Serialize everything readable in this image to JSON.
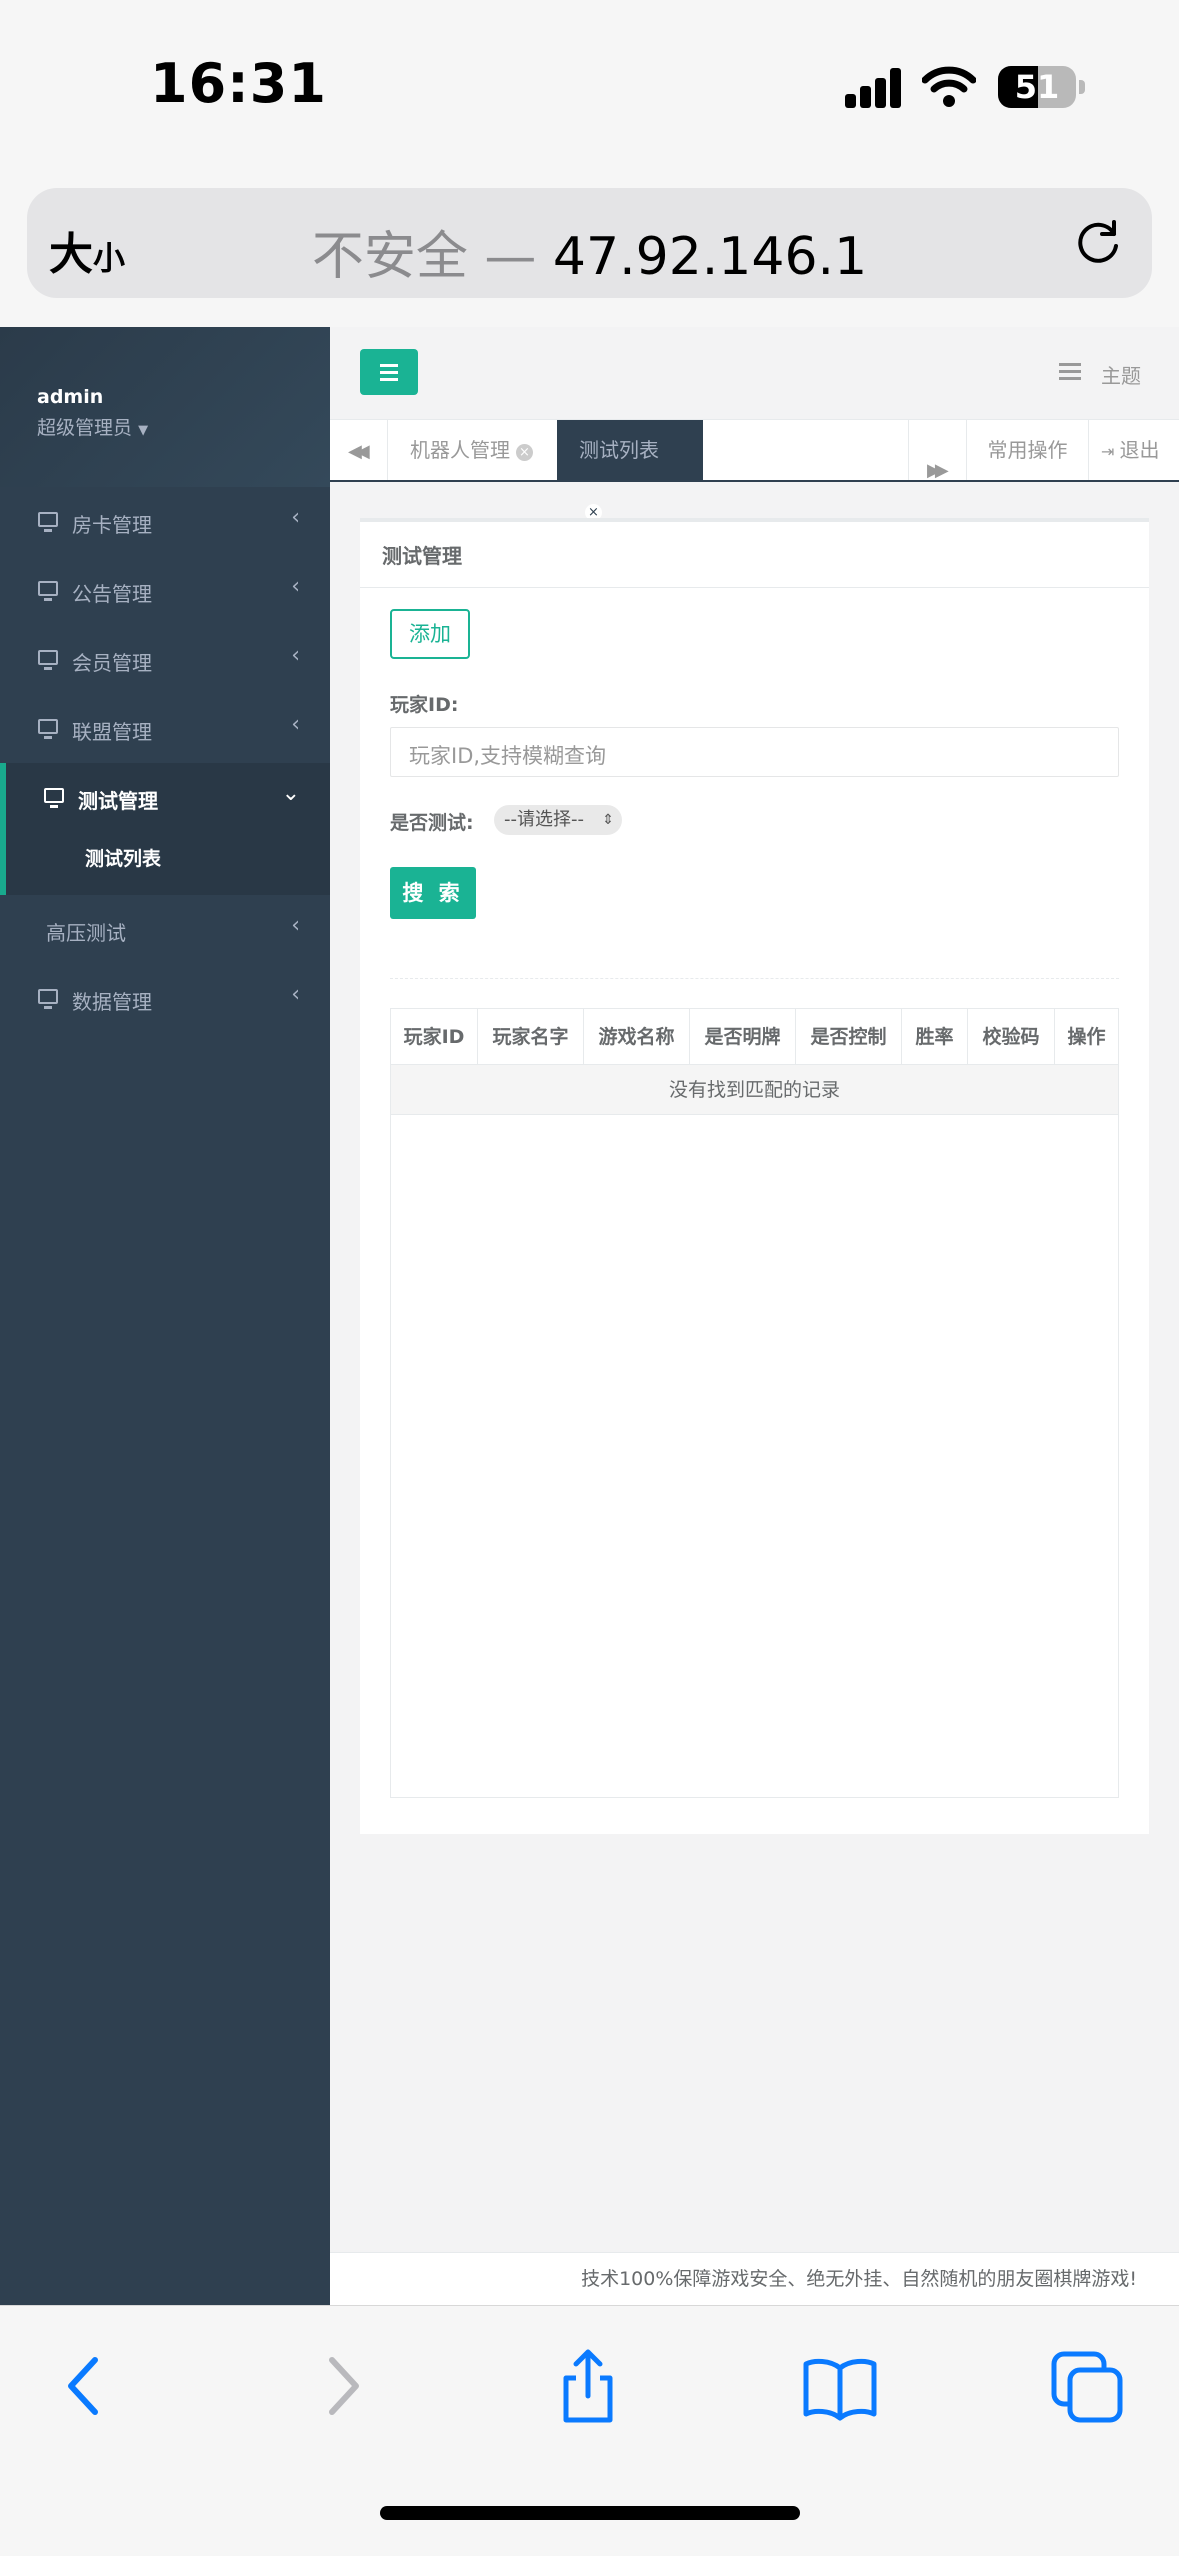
{
  "status": {
    "time": "16:31",
    "battery": "51",
    "battery_level": 0.51
  },
  "browser": {
    "text_size": "大",
    "text_size_small": "小",
    "insecure_label": "不安全",
    "separator": " — ",
    "host": "47.92.146.1"
  },
  "sidebar": {
    "user": "admin",
    "role": "超级管理员",
    "items": [
      {
        "label": "房卡管理"
      },
      {
        "label": "公告管理"
      },
      {
        "label": "会员管理"
      },
      {
        "label": "联盟管理"
      },
      {
        "label": "测试管理",
        "sub": "测试列表"
      },
      {
        "label": "高压测试"
      },
      {
        "label": "数据管理"
      }
    ]
  },
  "topnav": {
    "theme": "主题"
  },
  "tabs": {
    "items": [
      "机器人管理",
      "测试列表"
    ],
    "common_ops": "常用操作",
    "logout": "退出"
  },
  "panel": {
    "title": "测试管理",
    "add_button": "添加",
    "player_id_label": "玩家ID:",
    "player_id_placeholder": "玩家ID,支持模糊查询",
    "is_test_label": "是否测试:",
    "is_test_selected": "--请选择--",
    "search_button": "搜 索",
    "columns": [
      "玩家ID",
      "玩家名字",
      "游戏名称",
      "是否明牌",
      "是否控制",
      "胜率",
      "校验码",
      "操作"
    ],
    "empty_text": "没有找到匹配的记录"
  },
  "footer": {
    "text": "技术100%保障游戏安全、绝无外挂、自然随机的朋友圈棋牌游戏!"
  }
}
